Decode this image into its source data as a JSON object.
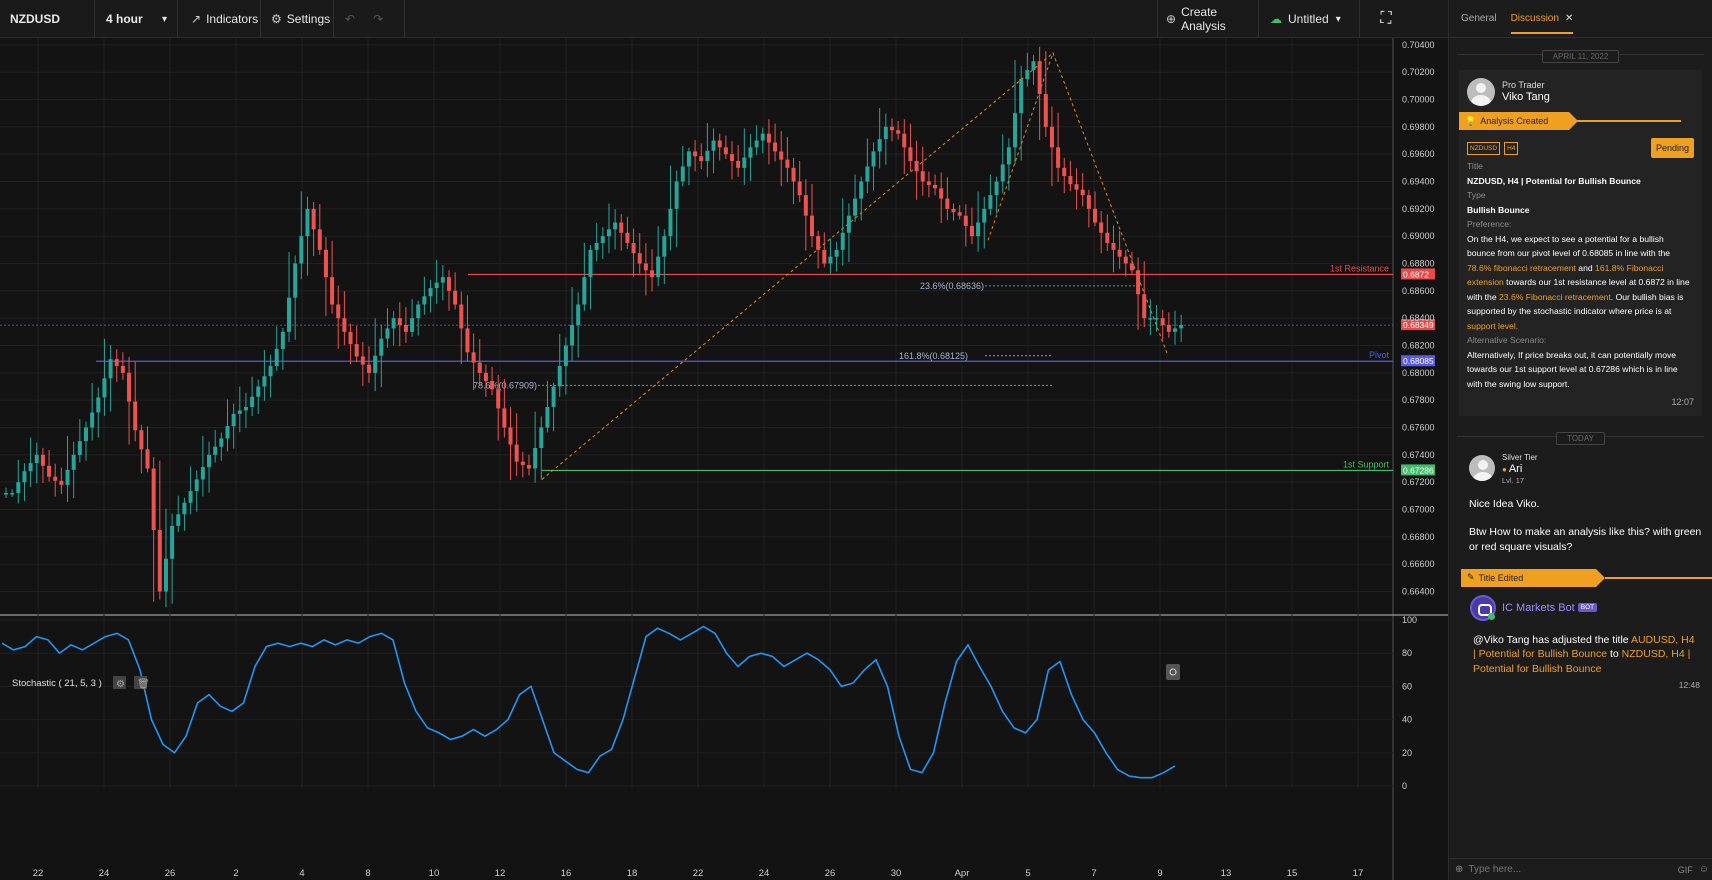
{
  "toolbar": {
    "symbol": "NZDUSD",
    "interval": "4 hour",
    "indicators_label": "Indicators",
    "settings_label": "Settings",
    "create_analysis_label": "Create Analysis",
    "layout_name": "Untitled"
  },
  "chart_data": {
    "type": "candlestick",
    "symbol": "NZDUSD",
    "interval": "4 hour",
    "price_axis": [
      "0.70400",
      "0.70200",
      "0.70000",
      "0.69800",
      "0.69600",
      "0.69400",
      "0.69200",
      "0.69000",
      "0.68800",
      "0.68600",
      "0.68400",
      "0.68200",
      "0.68000",
      "0.67800",
      "0.67600",
      "0.67400",
      "0.67200",
      "0.67000",
      "0.66800",
      "0.66600",
      "0.66400"
    ],
    "ylim": [
      0.6625,
      0.7045
    ],
    "time_axis": [
      "22",
      "24",
      "26",
      "2",
      "4",
      "8",
      "10",
      "12",
      "16",
      "18",
      "22",
      "24",
      "26",
      "30",
      "Apr",
      "5",
      "7",
      "9",
      "13",
      "15",
      "17"
    ],
    "close_points": [
      [
        0,
        0.6712
      ],
      [
        6,
        0.6728
      ],
      [
        12,
        0.674
      ],
      [
        18,
        0.6724
      ],
      [
        24,
        0.6718
      ],
      [
        30,
        0.674
      ],
      [
        36,
        0.676
      ],
      [
        42,
        0.6782
      ],
      [
        48,
        0.681
      ],
      [
        52,
        0.68
      ],
      [
        58,
        0.6758
      ],
      [
        64,
        0.673
      ],
      [
        68,
        0.664
      ],
      [
        72,
        0.6688
      ],
      [
        78,
        0.6705
      ],
      [
        84,
        0.6722
      ],
      [
        90,
        0.674
      ],
      [
        96,
        0.6752
      ],
      [
        102,
        0.677
      ],
      [
        108,
        0.6775
      ],
      [
        114,
        0.679
      ],
      [
        120,
        0.6805
      ],
      [
        126,
        0.683
      ],
      [
        132,
        0.688
      ],
      [
        136,
        0.692
      ],
      [
        140,
        0.689
      ],
      [
        146,
        0.685
      ],
      [
        152,
        0.683
      ],
      [
        158,
        0.6812
      ],
      [
        164,
        0.68
      ],
      [
        170,
        0.6825
      ],
      [
        176,
        0.684
      ],
      [
        182,
        0.683
      ],
      [
        188,
        0.685
      ],
      [
        194,
        0.6862
      ],
      [
        200,
        0.687
      ],
      [
        206,
        0.685
      ],
      [
        212,
        0.6815
      ],
      [
        218,
        0.68
      ],
      [
        224,
        0.6788
      ],
      [
        230,
        0.676
      ],
      [
        236,
        0.6735
      ],
      [
        240,
        0.673
      ],
      [
        246,
        0.676
      ],
      [
        252,
        0.679
      ],
      [
        258,
        0.682
      ],
      [
        264,
        0.685
      ],
      [
        270,
        0.689
      ],
      [
        276,
        0.69
      ],
      [
        282,
        0.691
      ],
      [
        288,
        0.6895
      ],
      [
        294,
        0.688
      ],
      [
        298,
        0.687
      ],
      [
        304,
        0.69
      ],
      [
        310,
        0.694
      ],
      [
        316,
        0.6962
      ],
      [
        322,
        0.6955
      ],
      [
        328,
        0.697
      ],
      [
        334,
        0.696
      ],
      [
        340,
        0.695
      ],
      [
        346,
        0.6965
      ],
      [
        352,
        0.6975
      ],
      [
        358,
        0.6962
      ],
      [
        364,
        0.695
      ],
      [
        370,
        0.693
      ],
      [
        376,
        0.69
      ],
      [
        382,
        0.688
      ],
      [
        386,
        0.689
      ],
      [
        392,
        0.6915
      ],
      [
        398,
        0.694
      ],
      [
        404,
        0.6962
      ],
      [
        410,
        0.698
      ],
      [
        416,
        0.6975
      ],
      [
        422,
        0.6955
      ],
      [
        428,
        0.694
      ],
      [
        434,
        0.6935
      ],
      [
        440,
        0.692
      ],
      [
        446,
        0.6915
      ],
      [
        452,
        0.69
      ],
      [
        458,
        0.692
      ],
      [
        464,
        0.694
      ],
      [
        470,
        0.6965
      ],
      [
        476,
        0.7015
      ],
      [
        482,
        0.7028
      ],
      [
        486,
        0.698
      ],
      [
        492,
        0.695
      ],
      [
        498,
        0.6938
      ],
      [
        504,
        0.693
      ],
      [
        510,
        0.691
      ],
      [
        516,
        0.6895
      ],
      [
        522,
        0.6885
      ],
      [
        528,
        0.6875
      ],
      [
        534,
        0.684
      ],
      [
        540,
        0.684
      ],
      [
        546,
        0.683
      ],
      [
        552,
        0.6835
      ]
    ],
    "horizontal_levels": [
      {
        "label": "1st Resistance",
        "price_tag": "0.6872",
        "color": "#e84a4a"
      },
      {
        "label": "Pivot",
        "price_tag": "0.68085",
        "color": "#5a5ae8"
      },
      {
        "label": "1st Support",
        "price_tag": "0.67286",
        "color": "#3fbf6a"
      }
    ],
    "current_price": "0.68349",
    "fib_labels": [
      "23.6%(0.68636)",
      "161.8%(0.68125)",
      "78.6%(0.67909)"
    ],
    "indicator": {
      "name": "Stochastic ( 21, 5, 3 )",
      "axis": [
        "100",
        "80",
        "60",
        "40",
        "20",
        "0"
      ],
      "ylim": [
        0,
        100
      ],
      "values": [
        86,
        82,
        84,
        90,
        88,
        80,
        85,
        82,
        86,
        90,
        92,
        88,
        70,
        40,
        25,
        20,
        30,
        50,
        55,
        48,
        45,
        50,
        72,
        84,
        86,
        84,
        86,
        84,
        88,
        85,
        88,
        86,
        90,
        92,
        88,
        62,
        45,
        35,
        32,
        28,
        30,
        34,
        30,
        34,
        40,
        55,
        60,
        40,
        20,
        15,
        10,
        8,
        18,
        22,
        40,
        65,
        90,
        95,
        92,
        88,
        92,
        96,
        92,
        80,
        72,
        78,
        80,
        78,
        72,
        76,
        80,
        76,
        70,
        60,
        62,
        70,
        76,
        60,
        30,
        10,
        8,
        20,
        50,
        75,
        85,
        72,
        60,
        45,
        35,
        32,
        40,
        70,
        75,
        55,
        40,
        32,
        20,
        10,
        6,
        5,
        5,
        8,
        12
      ]
    }
  },
  "panel": {
    "tabs": [
      "General",
      "Discussion"
    ],
    "active_tab": "Discussion",
    "date1": "APRIL 11, 2022",
    "post": {
      "tier": "Pro Trader",
      "author": "Viko Tang",
      "banner": "Analysis Created",
      "tag1": "NZDUSD",
      "tag2": "H4",
      "status": "Pending",
      "title_label": "Title",
      "title": "NZDUSD, H4 | Potential for Bullish Bounce",
      "type_label": "Type",
      "type": "Bullish Bounce",
      "pref_label": "Preference:",
      "pref_1": "On the H4,  we expect to see a potential for a bullish bounce from our pivot level of 0.68085 in line with the ",
      "pref_hl1": "78.6% fibonacci retracement",
      "pref_2": " and ",
      "pref_hl2": "161.8% Fibonacci extension",
      "pref_3": " towards our 1st resistance level at 0.6872 in line with the ",
      "pref_hl3": "23.6% Fibonacci retracement",
      "pref_4": ". Our bullish bias is supported by the stochastic indicator where price is at ",
      "pref_hl4": "support level.",
      "alt_label": "Alternative Scenario:",
      "alt": "Alternatively, If price breaks out, it can potentially move towards our 1st support level at 0.67286 which is in line with the swing low support.",
      "time": "12:07"
    },
    "date2": "TODAY",
    "comment": {
      "tier": "Silver Tier",
      "author": "Ari",
      "level": "Lvl. 17",
      "line1": "Nice Idea Viko.",
      "line2": "Btw How to make an analysis like this? with green or red square visuals?"
    },
    "event": {
      "banner": "Title Edited",
      "bot_name": "IC Markets Bot",
      "bot_badge": "BOT",
      "msg_1": "@Viko Tang  has adjusted the title ",
      "msg_hl1": "AUDUSD, H4 | Potential for Bullish Bounce",
      "msg_2": " to ",
      "msg_hl2": "NZDUSD, H4 | Potential for Bullish Bounce",
      "time": "12:48"
    },
    "input_placeholder": "Type here...",
    "gif_label": "GIF"
  },
  "colors": {
    "accent": "#f0a020",
    "up": "#26a69a",
    "down": "#ef5350",
    "stoch": "#2196f3"
  }
}
